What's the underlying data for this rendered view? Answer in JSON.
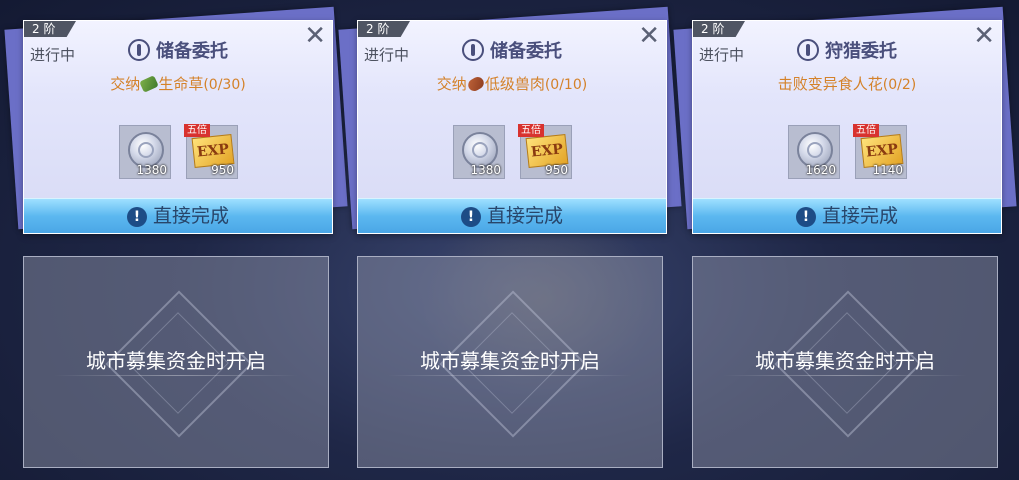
{
  "quests": [
    {
      "tier": "2 阶",
      "status": "进行中",
      "title": "储备委托",
      "task_prefix": "交纳",
      "task_item_icon": "herb-icon",
      "task_name": "生命草",
      "task_progress": "(0/30)",
      "rewards": [
        {
          "icon": "silver-coin-icon",
          "qty": "1380"
        },
        {
          "icon": "exp-ticket-icon",
          "badge": "五倍",
          "label": "EXP",
          "qty": "950"
        }
      ],
      "complete_label": "直接完成"
    },
    {
      "tier": "2 阶",
      "status": "进行中",
      "title": "储备委托",
      "task_prefix": "交纳",
      "task_item_icon": "meat-icon",
      "task_name": "低级兽肉",
      "task_progress": "(0/10)",
      "rewards": [
        {
          "icon": "silver-coin-icon",
          "qty": "1380"
        },
        {
          "icon": "exp-ticket-icon",
          "badge": "五倍",
          "label": "EXP",
          "qty": "950"
        }
      ],
      "complete_label": "直接完成"
    },
    {
      "tier": "2 阶",
      "status": "进行中",
      "title": "狩猎委托",
      "task_prefix": "",
      "task_item_icon": "",
      "task_name": "击败变异食人花",
      "task_progress": "(0/2)",
      "rewards": [
        {
          "icon": "silver-coin-icon",
          "qty": "1620"
        },
        {
          "icon": "exp-ticket-icon",
          "badge": "五倍",
          "label": "EXP",
          "qty": "1140"
        }
      ],
      "complete_label": "直接完成"
    }
  ],
  "locked_slots": [
    {
      "text": "城市募集资金时开启"
    },
    {
      "text": "城市募集资金时开启"
    },
    {
      "text": "城市募集资金时开启"
    }
  ],
  "colors": {
    "accent_button": "#5cb8f0",
    "task_text": "#d4822a",
    "back_card": "#6b6fc7"
  }
}
